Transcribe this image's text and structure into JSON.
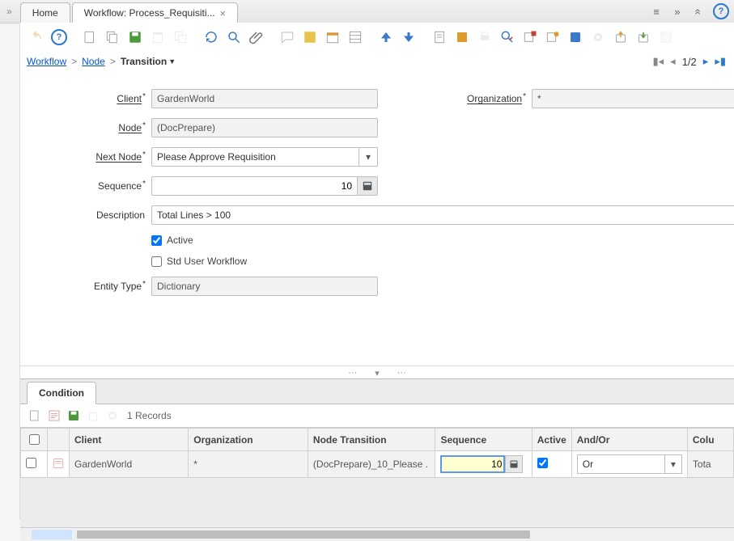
{
  "tabs": {
    "home": "Home",
    "current": "Workflow: Process_Requisiti..."
  },
  "breadcrumb": {
    "workflow": "Workflow",
    "node": "Node",
    "transition": "Transition"
  },
  "recnav": {
    "pos": "1/2"
  },
  "labels": {
    "client": "Client",
    "organization": "Organization",
    "node": "Node",
    "next_node": "Next Node",
    "sequence": "Sequence",
    "description": "Description",
    "active": "Active",
    "std_user_wf": "Std User Workflow",
    "entity_type": "Entity Type"
  },
  "form": {
    "client": "GardenWorld",
    "organization": "*",
    "node": "(DocPrepare)",
    "next_node": "Please Approve Requisition",
    "sequence": "10",
    "description": "Total Lines > 100",
    "active": true,
    "std_user_wf": false,
    "entity_type": "Dictionary"
  },
  "subtab": {
    "label": "Condition",
    "record_count": "1 Records"
  },
  "grid": {
    "headers": {
      "client": "Client",
      "organization": "Organization",
      "node_transition": "Node Transition",
      "sequence": "Sequence",
      "active": "Active",
      "and_or": "And/Or",
      "column": "Colu"
    },
    "row": {
      "client": "GardenWorld",
      "organization": "*",
      "node_transition": "(DocPrepare)_10_Please .",
      "sequence": "10",
      "active": true,
      "and_or": "Or",
      "column": "Tota"
    }
  }
}
